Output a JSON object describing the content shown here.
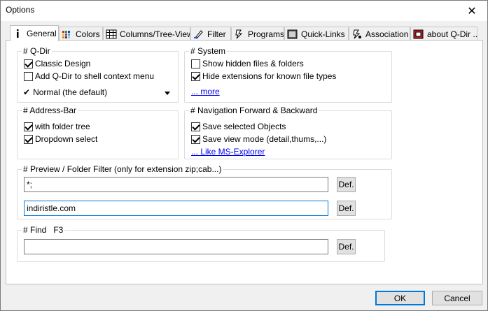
{
  "window": {
    "title": "Options",
    "close_glyph": "✕"
  },
  "tabs": [
    {
      "label": "General",
      "icon": "info-icon",
      "active": true
    },
    {
      "label": "Colors",
      "icon": "colors-icon"
    },
    {
      "label": "Columns/Tree-View",
      "icon": "columns-icon"
    },
    {
      "label": "Filter",
      "icon": "filter-icon"
    },
    {
      "label": "Programs",
      "icon": "programs-icon"
    },
    {
      "label": "Quick-Links",
      "icon": "quicklinks-icon"
    },
    {
      "label": "Association",
      "icon": "association-icon"
    },
    {
      "label": "about Q-Dir ...",
      "icon": "about-icon"
    }
  ],
  "qdir": {
    "title": "# Q-Dir",
    "classic_design": {
      "label": "Classic Design",
      "checked": true
    },
    "shell_menu": {
      "label": "Add Q-Dir to shell context menu",
      "checked": false
    },
    "mode": {
      "check": "✔",
      "label": "Normal (the default)"
    }
  },
  "system": {
    "title": "# System",
    "hidden_files": {
      "label": "Show hidden files & folders",
      "checked": false
    },
    "hide_ext": {
      "label": "Hide extensions for known file types",
      "checked": true
    },
    "more_link": "... more"
  },
  "address_bar": {
    "title": "# Address-Bar",
    "folder_tree": {
      "label": "with folder tree",
      "checked": true
    },
    "dropdown_select": {
      "label": "Dropdown select",
      "checked": true
    }
  },
  "navigation": {
    "title": "# Navigation Forward & Backward",
    "save_objects": {
      "label": "Save selected Objects",
      "checked": true
    },
    "save_view": {
      "label": "Save view mode (detail,thums,...)",
      "checked": true
    },
    "explorer_link": "... Like MS-Explorer"
  },
  "preview": {
    "title": "# Preview / Folder Filter (only for extension zip;cab...)",
    "filter_value": "*;",
    "exclude_value": "indiristle.com",
    "def_label": "Def."
  },
  "find": {
    "title": "# Find   F3",
    "value": "",
    "def_label": "Def."
  },
  "footer": {
    "ok_label": "OK",
    "cancel_label": "Cancel"
  },
  "colors": {
    "accent": "#0078d7",
    "link": "#0000ee",
    "dialog_bg": "#f0f0f0"
  }
}
